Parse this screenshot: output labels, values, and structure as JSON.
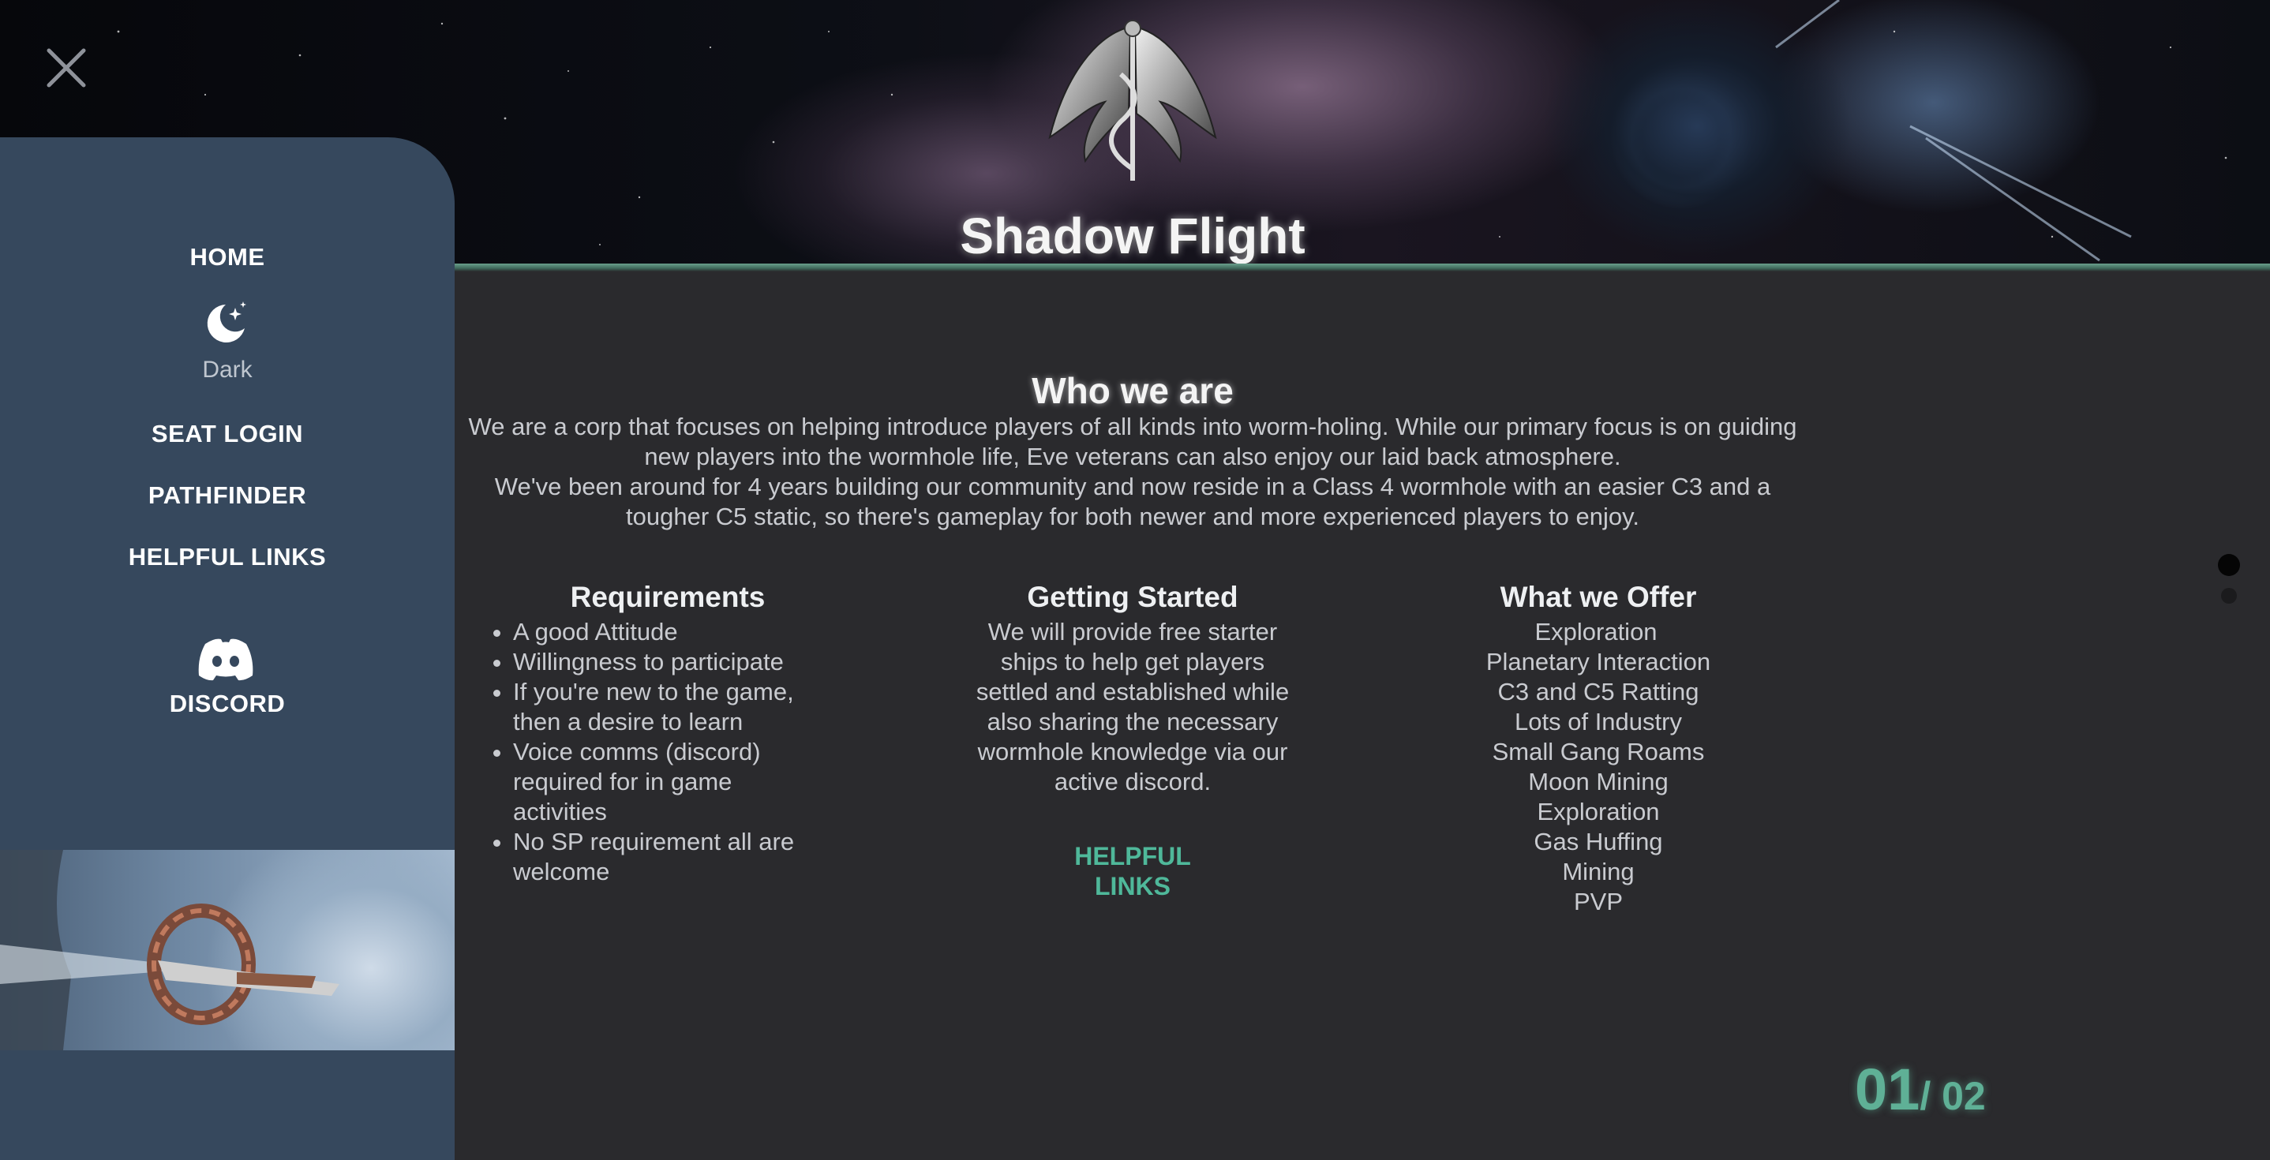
{
  "header": {
    "title": "Shadow Flight"
  },
  "close": {
    "icon": "close-icon"
  },
  "sidebar": {
    "items": {
      "home": "HOME",
      "theme": "Dark",
      "seat_login": "SEAT LOGIN",
      "pathfinder": "PATHFINDER",
      "helpful_links": "HELPFUL LINKS",
      "discord": "DISCORD"
    },
    "icons": {
      "theme": "moon-stars-icon",
      "discord": "discord-icon"
    }
  },
  "main": {
    "who_title": "Who we are",
    "intro": [
      "We are a corp that focuses on helping introduce players of all kinds into worm-holing. While our primary focus is on guiding new players into the wormhole life, Eve veterans can also enjoy our laid back atmosphere.",
      "We've been around for 4 years building our community and now reside in a Class 4 wormhole with an easier C3 and a tougher C5 static, so there's gameplay for both newer and more experienced players to enjoy."
    ],
    "requirements": {
      "title": "Requirements",
      "items": [
        "A good Attitude",
        "Willingness to participate",
        "If you're new to the game, then a desire to learn",
        "Voice comms (discord) required for in game activities",
        "No SP requirement all are welcome"
      ]
    },
    "getting_started": {
      "title": "Getting Started",
      "text": "We will provide free starter ships to help get players settled and established while also sharing the necessary wormhole knowledge via our active discord.",
      "link": "HELPFUL LINKS"
    },
    "offer": {
      "title": "What we Offer",
      "items": [
        "Exploration",
        "Planetary Interaction",
        "C3 and C5 Ratting",
        "Lots of Industry",
        "Small Gang Roams",
        "Moon Mining",
        "Exploration",
        "Gas Huffing",
        "Mining",
        "PVP"
      ]
    }
  },
  "pager": {
    "current": "01",
    "total": "/ 02"
  },
  "colors": {
    "sidebar": "#36485d",
    "background": "#2a2a2d",
    "accent": "#5fb096"
  }
}
